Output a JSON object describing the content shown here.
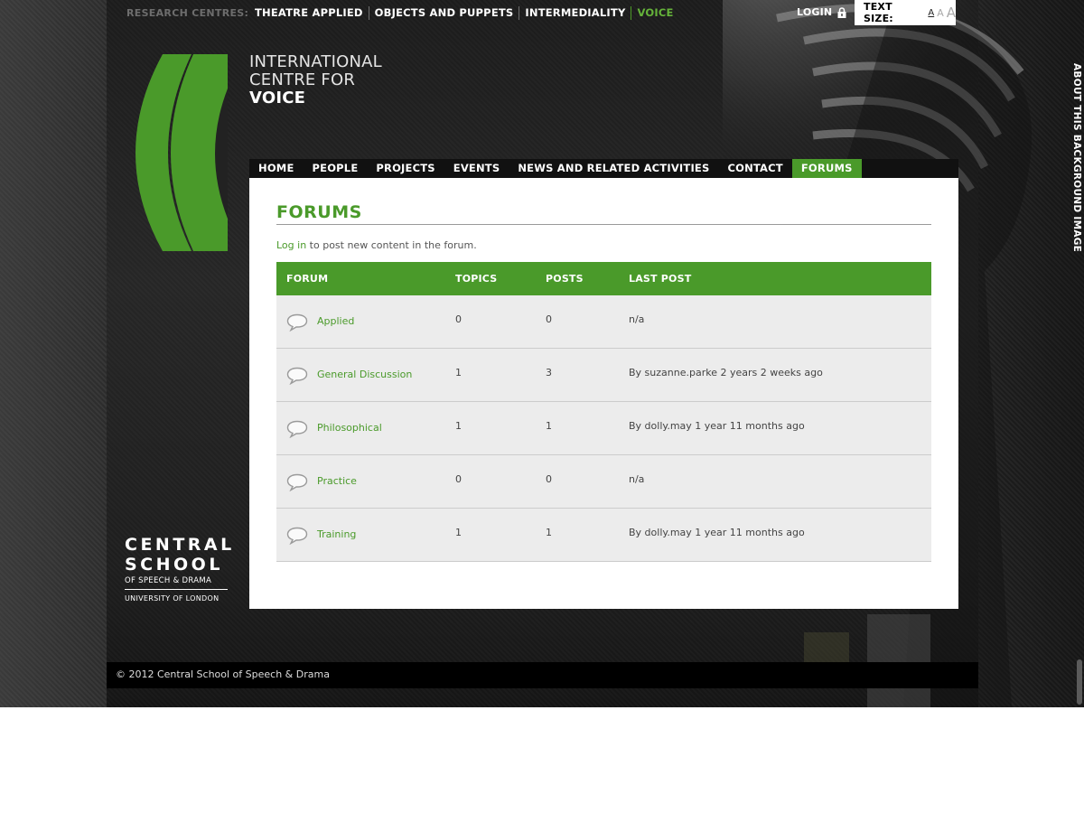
{
  "research_bar": {
    "label": "RESEARCH CENTRES:",
    "links": [
      {
        "label": "THEATRE APPLIED",
        "active": false
      },
      {
        "label": "OBJECTS AND PUPPETS",
        "active": false
      },
      {
        "label": "INTERMEDIALITY",
        "active": false
      },
      {
        "label": "VOICE",
        "active": true
      }
    ]
  },
  "utility": {
    "login_label": "LOGIN",
    "text_size_label": "TEXT SIZE:",
    "sizes": [
      "A",
      "A",
      "A"
    ]
  },
  "site_title": {
    "line1": "INTERNATIONAL",
    "line2": "CENTRE FOR",
    "line3": "VOICE"
  },
  "main_nav": [
    {
      "label": "HOME",
      "active": false
    },
    {
      "label": "PEOPLE",
      "active": false
    },
    {
      "label": "PROJECTS",
      "active": false
    },
    {
      "label": "EVENTS",
      "active": false
    },
    {
      "label": "NEWS AND RELATED ACTIVITIES",
      "active": false
    },
    {
      "label": "CONTACT",
      "active": false
    },
    {
      "label": "FORUMS",
      "active": true
    }
  ],
  "page": {
    "title": "FORUMS",
    "login_link": "Log in",
    "login_hint": " to post new content in the forum."
  },
  "forum_table": {
    "headers": [
      "FORUM",
      "TOPICS",
      "POSTS",
      "LAST POST"
    ],
    "rows": [
      {
        "forum": "Applied",
        "topics": "0",
        "posts": "0",
        "last_post": "n/a"
      },
      {
        "forum": "General Discussion",
        "topics": "1",
        "posts": "3",
        "last_post": "By suzanne.parke 2 years 2 weeks ago"
      },
      {
        "forum": "Philosophical",
        "topics": "1",
        "posts": "1",
        "last_post": "By dolly.may 1 year 11 months ago"
      },
      {
        "forum": "Practice",
        "topics": "0",
        "posts": "0",
        "last_post": "n/a"
      },
      {
        "forum": "Training",
        "topics": "1",
        "posts": "1",
        "last_post": "By dolly.may 1 year 11 months ago"
      }
    ]
  },
  "school_logo": {
    "line1": "CENTRAL",
    "line2": "SCHOOL",
    "line3": "OF SPEECH & DRAMA",
    "line4": "UNIVERSITY OF LONDON"
  },
  "footer": {
    "copyright": "© 2012 Central School of Speech & Drama"
  },
  "side_tab": {
    "label": "ABOUT THIS BACKGROUND IMAGE"
  },
  "colors": {
    "accent": "#4a9a2a",
    "accent_light": "#65b33a",
    "row_bg": "#ececec",
    "nav_bg": "#111111"
  },
  "icons": {
    "lock": "lock-icon",
    "forum": "speech-bubble-icon"
  }
}
